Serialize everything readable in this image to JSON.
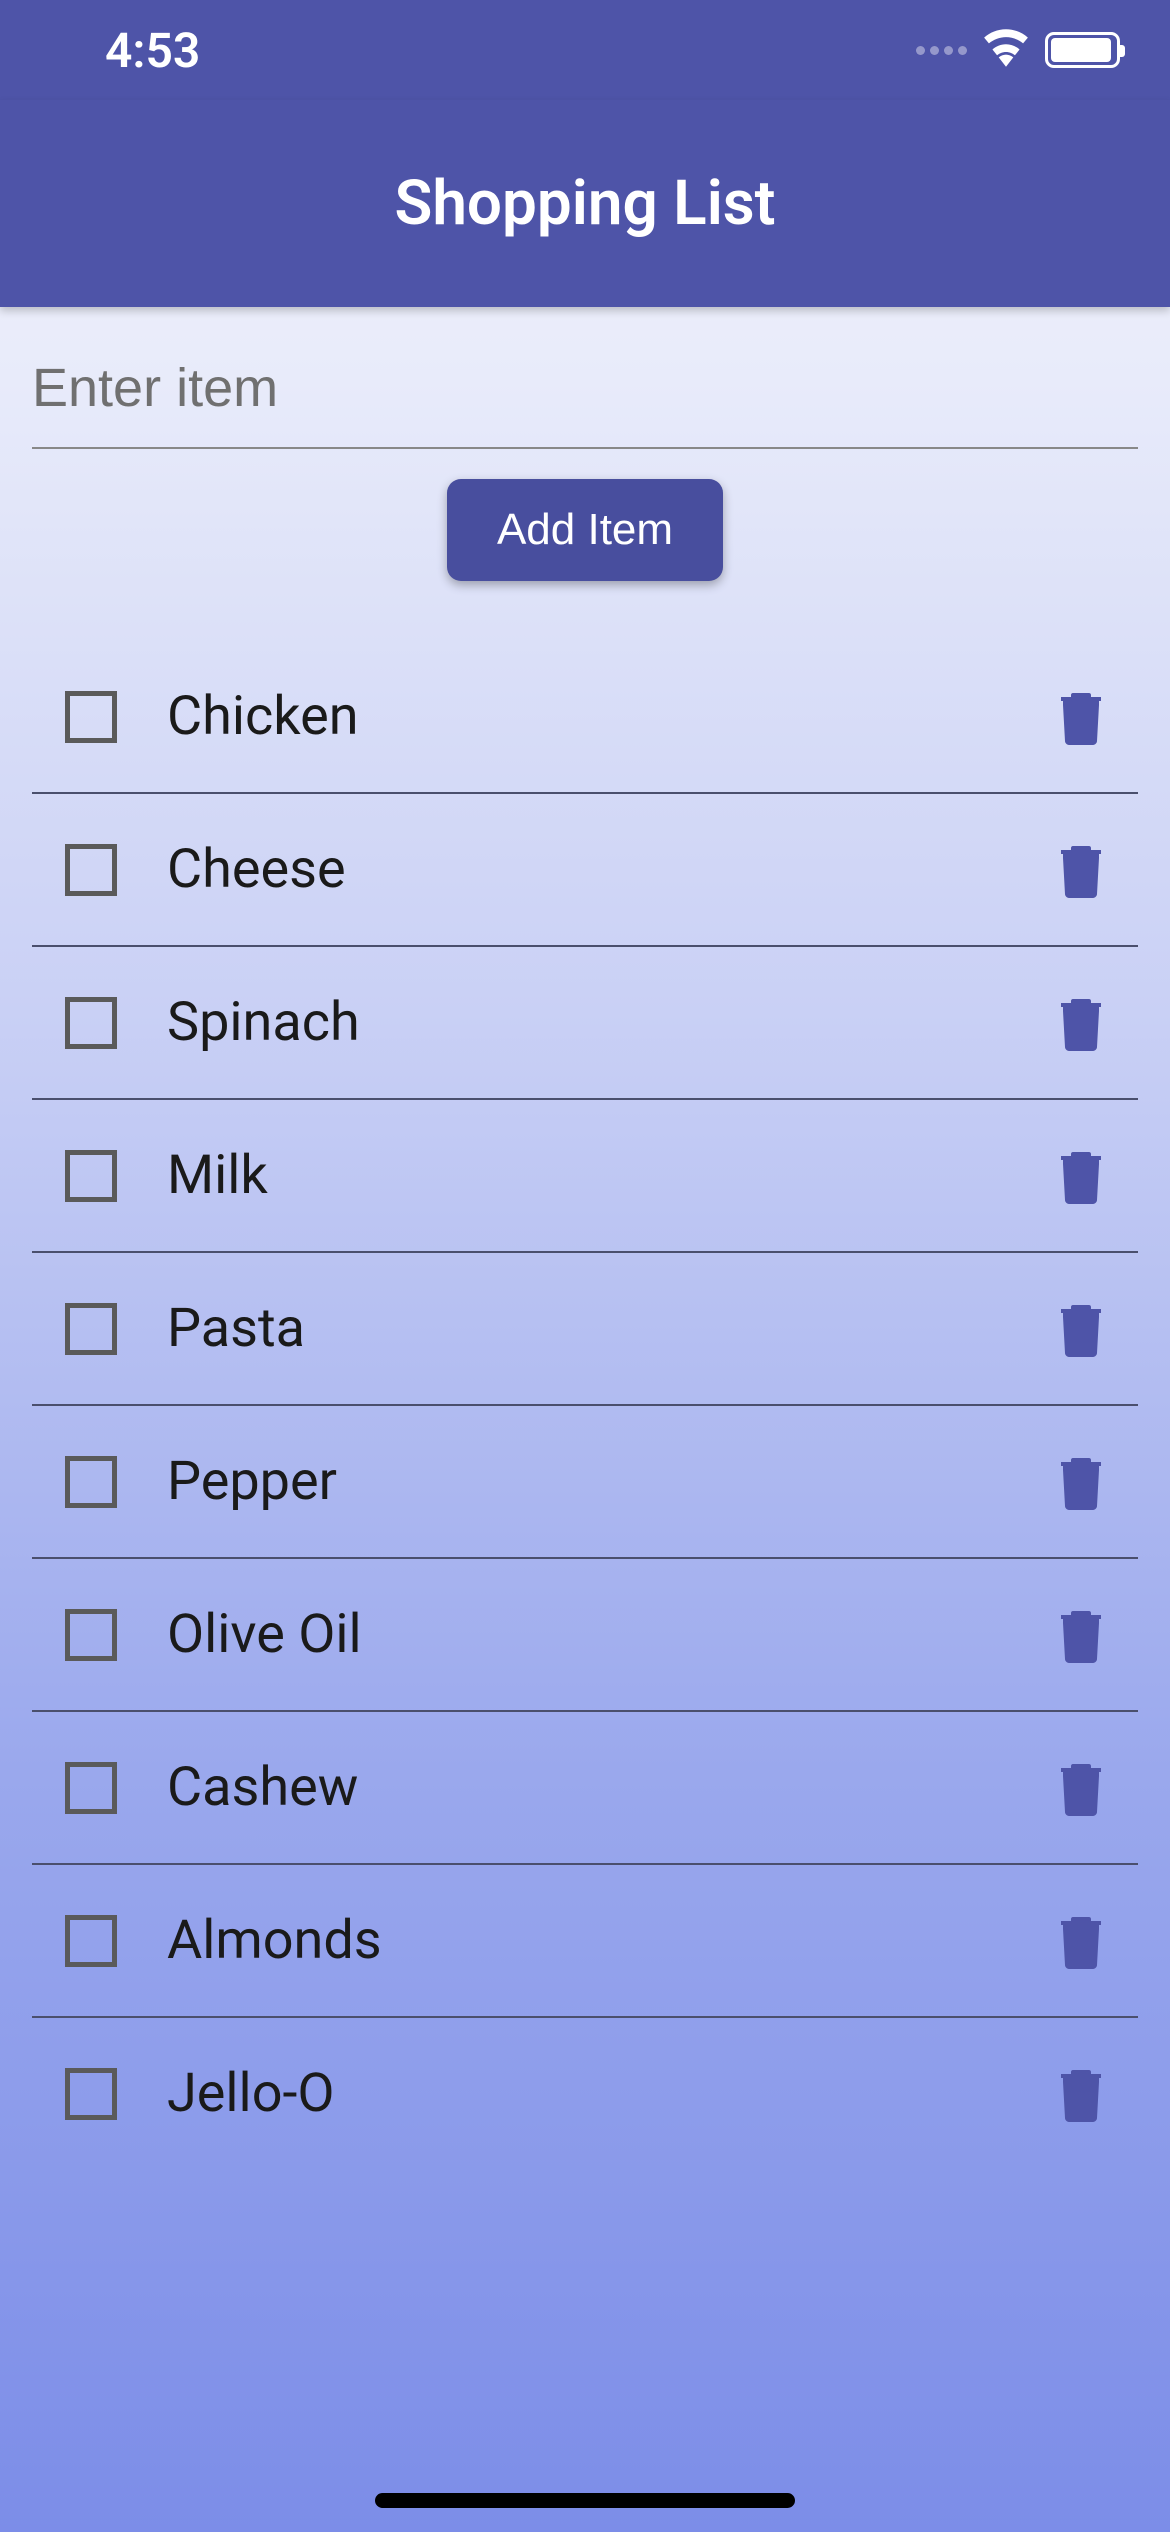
{
  "status_bar": {
    "time": "4:53"
  },
  "header": {
    "title": "Shopping List"
  },
  "input": {
    "placeholder": "Enter item",
    "value": ""
  },
  "add_button_label": "Add Item",
  "items": [
    {
      "name": "Chicken",
      "checked": false
    },
    {
      "name": "Cheese",
      "checked": false
    },
    {
      "name": "Spinach",
      "checked": false
    },
    {
      "name": "Milk",
      "checked": false
    },
    {
      "name": "Pasta",
      "checked": false
    },
    {
      "name": "Pepper",
      "checked": false
    },
    {
      "name": "Olive Oil",
      "checked": false
    },
    {
      "name": "Cashew",
      "checked": false
    },
    {
      "name": "Almonds",
      "checked": false
    },
    {
      "name": "Jello-O",
      "checked": false
    }
  ]
}
